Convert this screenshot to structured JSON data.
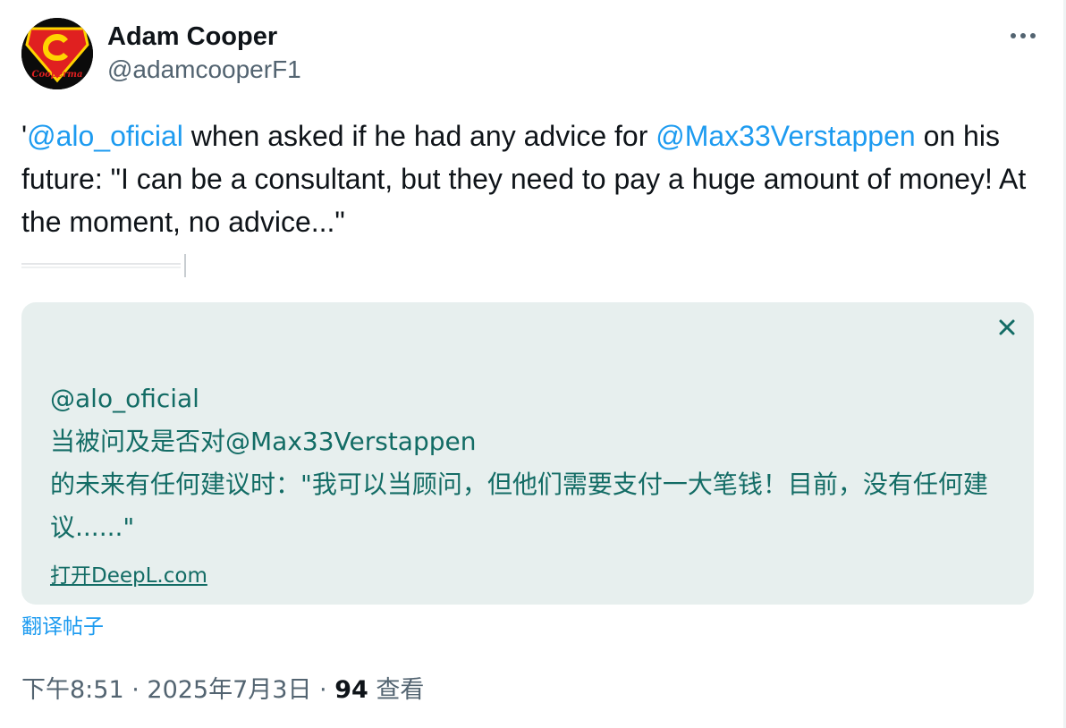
{
  "author": {
    "display_name": "Adam Cooper",
    "handle": "@adamcooperF1",
    "avatar_text": "Cooperma"
  },
  "header": {
    "more_icon": "more-horizontal-icon"
  },
  "tweet": {
    "prefix": "'",
    "mention_1": "@alo_oficial",
    "text_1": " when asked if he had any advice for ",
    "mention_2": "@Max33Verstappen",
    "text_2": " on his future: \"I can be a consultant, but they need to pay a huge amount of money! At the moment, no advice...\""
  },
  "translation": {
    "close_icon": "close-icon",
    "line_1": "@alo_oficial",
    "line_2": "当被问及是否对@Max33Verstappen",
    "line_3": "的未来有任何建议时：\"我可以当顾问，但他们需要支付一大笔钱！目前，没有任何建议......\"",
    "link_label": "打开DeepL.com"
  },
  "translate_post_label": "翻译帖子",
  "meta": {
    "time": "下午8:51",
    "sep_1": " · ",
    "date": "2025年7月3日",
    "sep_2": " · ",
    "views_count": "94",
    "views_label": " 查看"
  },
  "colors": {
    "link_blue": "#1d9bf0",
    "translation_bg": "#e7efee",
    "translation_text": "#136c65",
    "secondary_text": "#536471"
  }
}
